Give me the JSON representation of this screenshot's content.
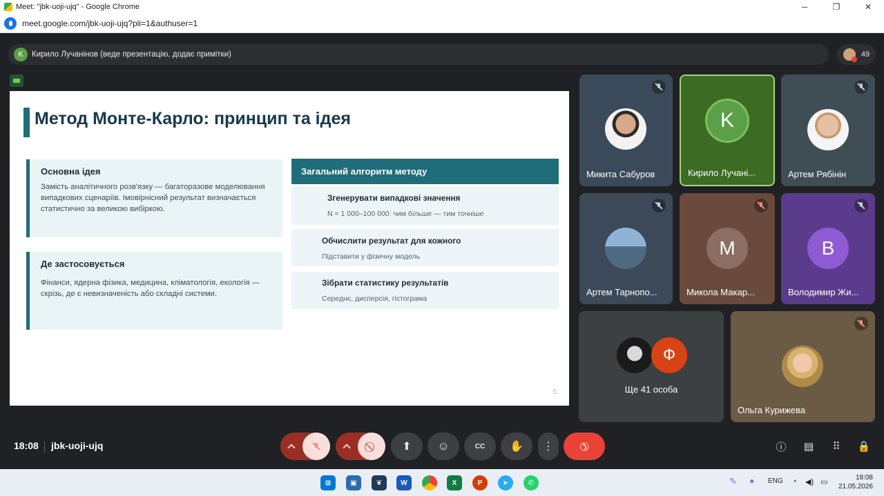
{
  "window": {
    "title": "Meet: \"jbk-uoji-ujq\" - Google Chrome",
    "url": "meet.google.com/jbk-uoji-ujq?pli=1&authuser=1"
  },
  "presenter": {
    "initial": "K",
    "text": "Кирило Лучанінов (веде презентацію, додає примітки)"
  },
  "participants_count": "49",
  "slide": {
    "title": "Метод Монте-Карло: принцип та ідея",
    "idea_title": "Основна ідея",
    "idea_body": "Замість аналітичного розв'язку — багаторазове моделювання випадкових сценаріїв. Імовірнісний результат визначається статистично за великою вибіркою.",
    "usage_title": "Де застосовується",
    "usage_body": "Фінанси, ядерна фізика, медицина, кліматологія, екологія — скрізь, де є невизначеність або складні системи.",
    "algo_title": "Загальний алгоритм методу",
    "steps": [
      {
        "title": "Згенерувати випадкові значення",
        "desc": "N = 1 000–100 000: чим більше — тим точніше"
      },
      {
        "title": "Обчислити результат для кожного",
        "desc": "Підставити у  фізичну модель"
      },
      {
        "title": "Зібрати статистику результатів",
        "desc": "Середнє, дисперсія, гістограма"
      }
    ],
    "page_number": "5"
  },
  "tiles": [
    {
      "name": "Микита Сабуров"
    },
    {
      "name": "Кирило Лучані...",
      "initial": "K"
    },
    {
      "name": "Артем Рябінін"
    },
    {
      "name": "Артем Тарнопо..."
    },
    {
      "name": "Микола Макар...",
      "initial": "M"
    },
    {
      "name": "Володимир Жи...",
      "initial": "B"
    },
    {
      "name": "Ще 41 особа",
      "initial": "Ф"
    },
    {
      "name": "Ольга Курижева"
    }
  ],
  "controls": {
    "time": "18:08",
    "meeting_code": "jbk-uoji-ujq"
  },
  "taskbar": {
    "language": "ENG",
    "time": "18:08",
    "date": "21.05.2026"
  },
  "colors": {
    "accent": "#1f6d7a",
    "hangup": "#ea4335",
    "active_border": "#a8d672"
  }
}
